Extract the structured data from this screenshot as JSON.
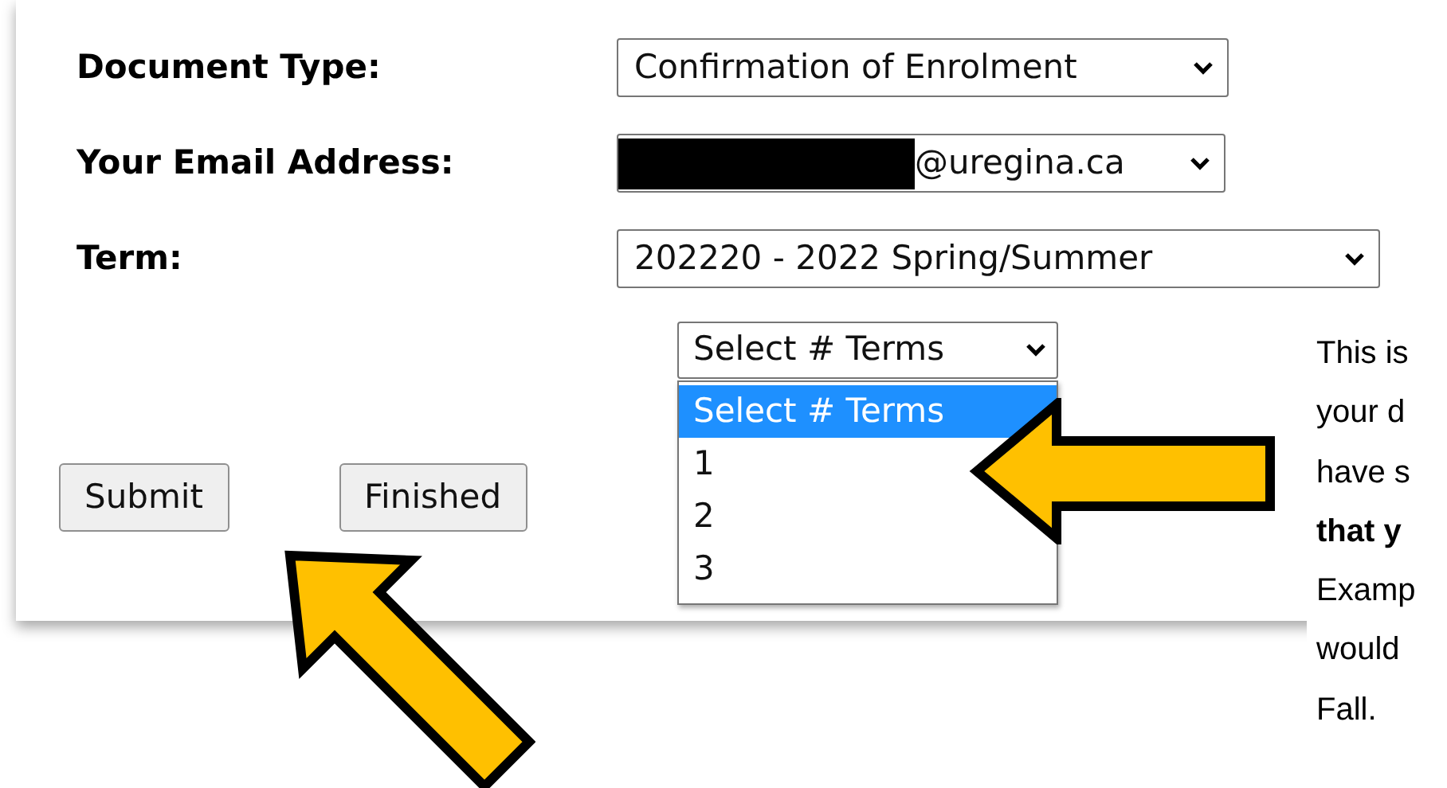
{
  "form": {
    "fields": [
      {
        "label": "Document Type:",
        "value": "Confirmation of Enrolment",
        "redacted": false
      },
      {
        "label": "Your Email Address:",
        "value": "@uregina.ca",
        "redacted": true
      },
      {
        "label": "Term:",
        "value": "202220 - 2022 Spring/Summer",
        "redacted": false
      }
    ],
    "terms_select": {
      "value": "Select # Terms",
      "expanded": true,
      "options": [
        {
          "label": "Select # Terms",
          "selected": true
        },
        {
          "label": "1",
          "selected": false
        },
        {
          "label": "2",
          "selected": false
        },
        {
          "label": "3",
          "selected": false
        }
      ]
    },
    "buttons": [
      "Submit",
      "Finished"
    ]
  },
  "note_lines": [
    {
      "text": "This is",
      "bold": false
    },
    {
      "text": "your d",
      "bold": false
    },
    {
      "text": "have s",
      "bold": false
    },
    {
      "text": "that y",
      "bold": true
    },
    {
      "text": "Examp",
      "bold": false
    },
    {
      "text": "would",
      "bold": false
    },
    {
      "text": "Fall.",
      "bold": false
    }
  ]
}
